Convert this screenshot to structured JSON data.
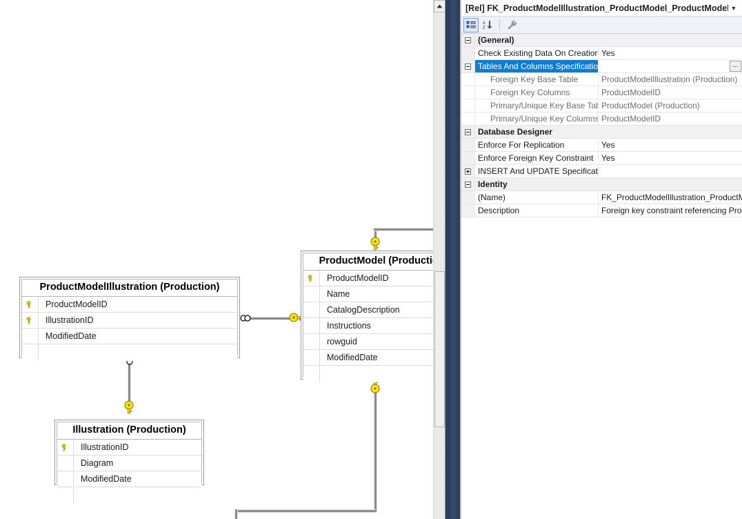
{
  "properties_panel": {
    "header_title": "[Rel] FK_ProductModelIllustration_ProductModel_ProductModelID",
    "header_chevron": "chevron-down-icon",
    "toolbar": {
      "categorized_label": "Categorized",
      "alphabetical_label": "Alphabetical",
      "property_pages_label": "Property Pages"
    },
    "rows": [
      {
        "kind": "category",
        "expander": "minus",
        "name": "(General)",
        "value": ""
      },
      {
        "kind": "property",
        "expander": "none",
        "name": "Check Existing Data On Creation",
        "value": "Yes"
      },
      {
        "kind": "property_selected",
        "expander": "minus",
        "name": "Tables And Columns Specification",
        "value": "",
        "ellipsis": "..."
      },
      {
        "kind": "sub",
        "expander": "none",
        "name": "Foreign Key Base Table",
        "value": "ProductModelIllustration (Production)"
      },
      {
        "kind": "sub",
        "expander": "none",
        "name": "Foreign Key Columns",
        "value": "ProductModelID"
      },
      {
        "kind": "sub",
        "expander": "none",
        "name": "Primary/Unique Key Base Table",
        "value": "ProductModel (Production)"
      },
      {
        "kind": "sub",
        "expander": "none",
        "name": "Primary/Unique Key Columns",
        "value": "ProductModelID"
      },
      {
        "kind": "category",
        "expander": "minus",
        "name": "Database Designer",
        "value": ""
      },
      {
        "kind": "property",
        "expander": "none",
        "name": "Enforce For Replication",
        "value": "Yes"
      },
      {
        "kind": "property",
        "expander": "none",
        "name": "Enforce Foreign Key Constraint",
        "value": "Yes"
      },
      {
        "kind": "property",
        "expander": "plus",
        "name": "INSERT And UPDATE Specification",
        "value": ""
      },
      {
        "kind": "category",
        "expander": "minus",
        "name": "Identity",
        "value": ""
      },
      {
        "kind": "property",
        "expander": "none",
        "name": "(Name)",
        "value": "FK_ProductModelIllustration_ProductModelID"
      },
      {
        "kind": "property",
        "expander": "none",
        "name": "Description",
        "value": "Foreign key constraint referencing ProductModel.ProductModelID."
      }
    ]
  },
  "designer": {
    "tables": [
      {
        "id": "product-model-illustration",
        "title": "ProductModelIllustration (Production)",
        "columns": [
          {
            "name": "ProductModelID",
            "key": true
          },
          {
            "name": "IllustrationID",
            "key": true
          },
          {
            "name": "ModifiedDate",
            "key": false
          }
        ]
      },
      {
        "id": "product-model",
        "title": "ProductModel (Production)",
        "columns": [
          {
            "name": "ProductModelID",
            "key": true
          },
          {
            "name": "Name",
            "key": false
          },
          {
            "name": "CatalogDescription",
            "key": false
          },
          {
            "name": "Instructions",
            "key": false
          },
          {
            "name": "rowguid",
            "key": false
          },
          {
            "name": "ModifiedDate",
            "key": false
          }
        ]
      },
      {
        "id": "illustration",
        "title": "Illustration (Production)",
        "columns": [
          {
            "name": "IllustrationID",
            "key": true
          },
          {
            "name": "Diagram",
            "key": false
          },
          {
            "name": "ModifiedDate",
            "key": false
          }
        ]
      }
    ],
    "relationships": [
      {
        "id": "pmi-to-pm",
        "from": "ProductModelIllustration",
        "to": "ProductModel",
        "from_cardinality": "many",
        "to_cardinality": "one-key"
      },
      {
        "id": "pmi-to-illustration",
        "from": "ProductModelIllustration",
        "to": "Illustration",
        "from_cardinality": "many",
        "to_cardinality": "one-key"
      },
      {
        "id": "pm-top",
        "from": "ProductModel",
        "to": "ProductModel",
        "from_cardinality": "one-key",
        "to_cardinality": "one-key"
      },
      {
        "id": "pm-bottom",
        "from": "ProductModel",
        "to": "ProductModel",
        "from_cardinality": "one-key",
        "to_cardinality": "one-key"
      }
    ],
    "scrollbar": {
      "up_arrow": "scroll-up-arrow-icon",
      "thumb": "scrollbar-thumb"
    }
  }
}
